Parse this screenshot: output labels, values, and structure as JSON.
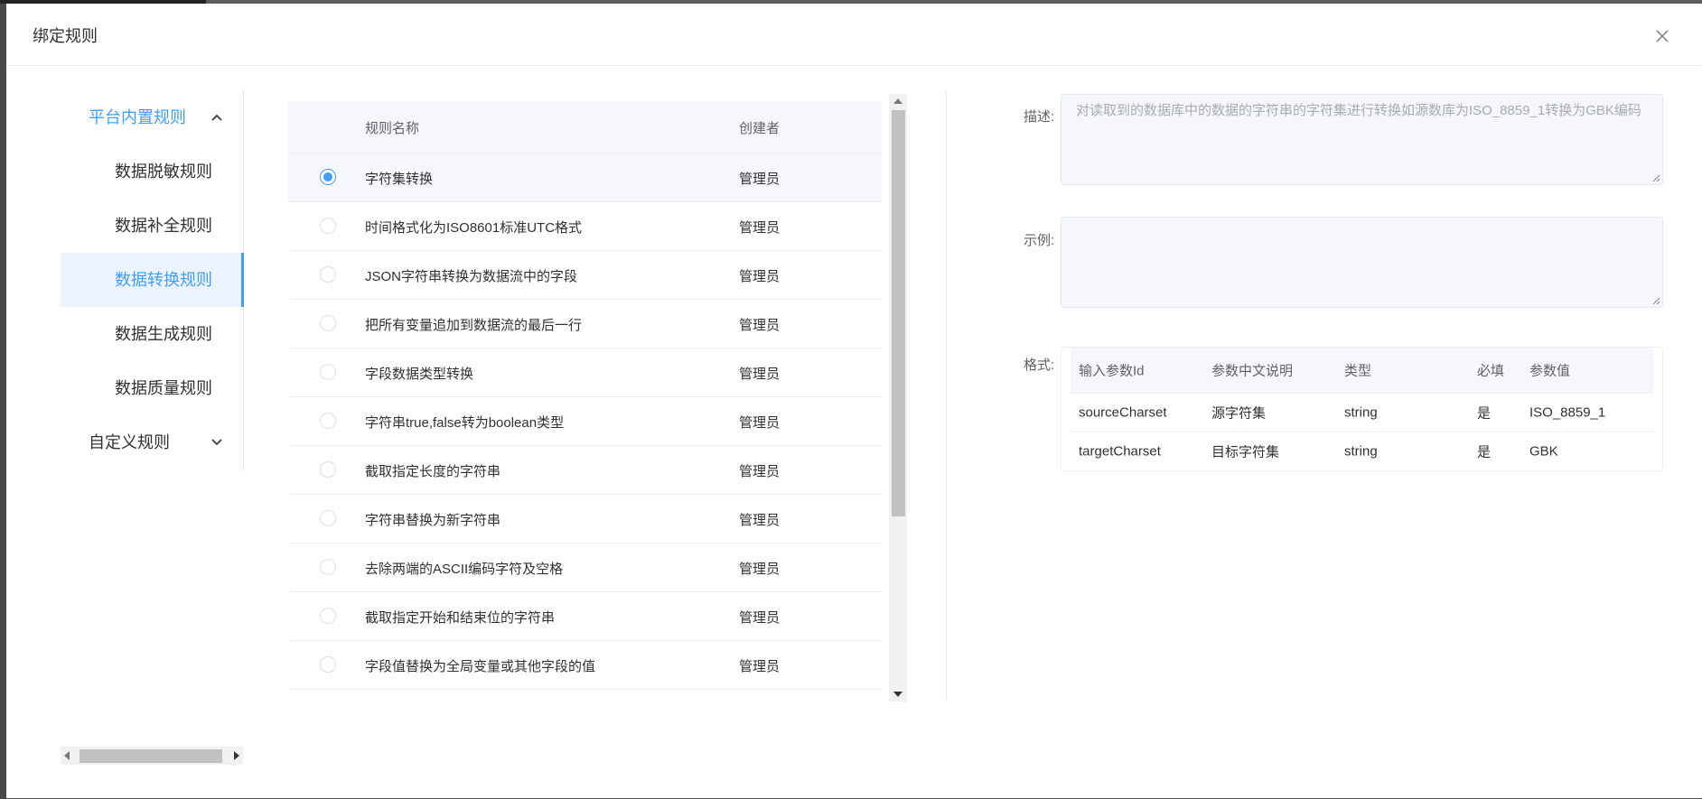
{
  "dialog": {
    "title": "绑定规则"
  },
  "menu": {
    "groups": [
      {
        "label": "平台内置规则",
        "expanded": true
      },
      {
        "label": "自定义规则",
        "expanded": false
      }
    ],
    "items": [
      {
        "label": "数据脱敏规则"
      },
      {
        "label": "数据补全规则"
      },
      {
        "label": "数据转换规则",
        "selected": true
      },
      {
        "label": "数据生成规则"
      },
      {
        "label": "数据质量规则"
      }
    ]
  },
  "rule_table": {
    "headers": {
      "name": "规则名称",
      "owner": "创建者"
    },
    "rows": [
      {
        "name": "字符集转换",
        "owner": "管理员",
        "checked": true
      },
      {
        "name": "时间格式化为ISO8601标准UTC格式",
        "owner": "管理员"
      },
      {
        "name": "JSON字符串转换为数据流中的字段",
        "owner": "管理员"
      },
      {
        "name": "把所有变量追加到数据流的最后一行",
        "owner": "管理员"
      },
      {
        "name": "字段数据类型转换",
        "owner": "管理员"
      },
      {
        "name": "字符串true,false转为boolean类型",
        "owner": "管理员"
      },
      {
        "name": "截取指定长度的字符串",
        "owner": "管理员"
      },
      {
        "name": "字符串替换为新字符串",
        "owner": "管理员"
      },
      {
        "name": "去除两端的ASCII编码字符及空格",
        "owner": "管理员"
      },
      {
        "name": "截取指定开始和结束位的字符串",
        "owner": "管理员"
      },
      {
        "name": "字段值替换为全局变量或其他字段的值",
        "owner": "管理员"
      }
    ]
  },
  "detail": {
    "desc_label": "描述:",
    "desc_value": "对读取到的数据库中的数据的字符串的字符集进行转换如源数库为ISO_8859_1转换为GBK编码",
    "example_label": "示例:",
    "example_value": "",
    "format_label": "格式:",
    "params": {
      "headers": [
        "输入参数Id",
        "参数中文说明",
        "类型",
        "必填",
        "参数值"
      ],
      "rows": [
        [
          "sourceCharset",
          "源字符集",
          "string",
          "是",
          "ISO_8859_1"
        ],
        [
          "targetCharset",
          "目标字符集",
          "string",
          "是",
          "GBK"
        ]
      ]
    }
  },
  "colors": {
    "accent": "#409eff",
    "text": "#303133",
    "muted": "#606266"
  }
}
